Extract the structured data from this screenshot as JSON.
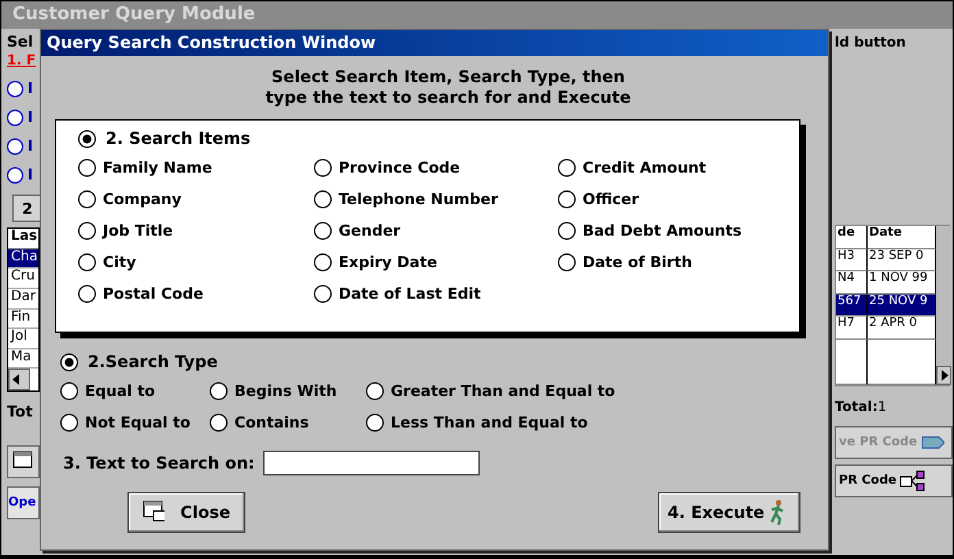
{
  "background_window": {
    "title": "Customer Query Module",
    "left": {
      "label": "Sel",
      "step_link": "1. F",
      "options": [
        {
          "label": "I",
          "selected": false
        },
        {
          "label": "I",
          "selected": false
        },
        {
          "label": "I",
          "selected": false
        },
        {
          "label": "I",
          "selected": false
        }
      ],
      "button": "2",
      "table": {
        "header": "Las",
        "rows": [
          {
            "cell": "Cha",
            "selected": true
          },
          {
            "cell": "Cru",
            "selected": false
          },
          {
            "cell": "Dar",
            "selected": false
          },
          {
            "cell": "Fin",
            "selected": false
          },
          {
            "cell": "Jol",
            "selected": false
          },
          {
            "cell": "Ma",
            "selected": false
          }
        ]
      },
      "total": "Tot",
      "open_button": "Ope"
    },
    "right": {
      "hint": "ld button",
      "table": {
        "columns": [
          "de",
          "Date"
        ],
        "rows": [
          {
            "cells": [
              "H3",
              "23 SEP 0"
            ],
            "selected": false
          },
          {
            "cells": [
              "N4",
              "1 NOV 99"
            ],
            "selected": false
          },
          {
            "cells": [
              "567",
              "25 NOV 9"
            ],
            "selected": true
          },
          {
            "cells": [
              "H7",
              "2 APR 0"
            ],
            "selected": false
          }
        ]
      },
      "total_label": "Total:",
      "total_value": "1",
      "buttons": [
        {
          "label": "ve PR Code",
          "kind": "save",
          "disabled": true
        },
        {
          "label": "PR Code",
          "kind": "tree",
          "disabled": false
        }
      ]
    }
  },
  "dialog": {
    "title": "Query Search Construction Window",
    "instructions": [
      "Select Search Item, Search Type, then",
      "type the text to search for and Execute"
    ],
    "search_items": {
      "label": "2. Search Items",
      "selected": true,
      "options": [
        {
          "label": "Family Name",
          "selected": false
        },
        {
          "label": "Province Code",
          "selected": false
        },
        {
          "label": "Credit Amount",
          "selected": false
        },
        {
          "label": "Company",
          "selected": false
        },
        {
          "label": "Telephone Number",
          "selected": false
        },
        {
          "label": "Officer",
          "selected": false
        },
        {
          "label": "Job Title",
          "selected": false
        },
        {
          "label": "Gender",
          "selected": false
        },
        {
          "label": "Bad Debt Amounts",
          "selected": false
        },
        {
          "label": "City",
          "selected": false
        },
        {
          "label": "Expiry Date",
          "selected": false
        },
        {
          "label": "Date of Birth",
          "selected": false
        },
        {
          "label": "Postal Code",
          "selected": false
        },
        {
          "label": "Date of Last Edit",
          "selected": false
        }
      ]
    },
    "search_type": {
      "label": "2.Search Type",
      "selected": true,
      "options": [
        {
          "label": "Equal to",
          "selected": false
        },
        {
          "label": "Begins With",
          "selected": false
        },
        {
          "label": "Greater Than and Equal to",
          "selected": false
        },
        {
          "label": "Not Equal to",
          "selected": false
        },
        {
          "label": "Contains",
          "selected": false
        },
        {
          "label": "Less Than and Equal to",
          "selected": false
        }
      ]
    },
    "text_field": {
      "label": "3. Text to Search on:"
    },
    "buttons": [
      {
        "label": "Close",
        "kind": "close"
      },
      {
        "label": "4. Execute",
        "kind": "execute"
      }
    ]
  }
}
